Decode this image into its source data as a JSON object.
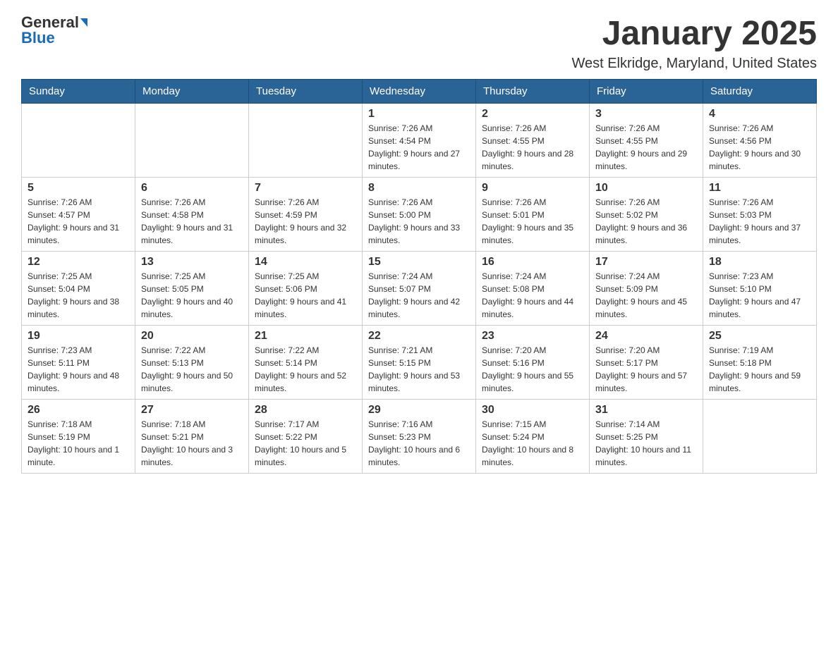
{
  "header": {
    "logo_general": "General",
    "logo_blue": "Blue",
    "title": "January 2025",
    "subtitle": "West Elkridge, Maryland, United States"
  },
  "days_of_week": [
    "Sunday",
    "Monday",
    "Tuesday",
    "Wednesday",
    "Thursday",
    "Friday",
    "Saturday"
  ],
  "weeks": [
    [
      {
        "day": "",
        "info": ""
      },
      {
        "day": "",
        "info": ""
      },
      {
        "day": "",
        "info": ""
      },
      {
        "day": "1",
        "info": "Sunrise: 7:26 AM\nSunset: 4:54 PM\nDaylight: 9 hours and 27 minutes."
      },
      {
        "day": "2",
        "info": "Sunrise: 7:26 AM\nSunset: 4:55 PM\nDaylight: 9 hours and 28 minutes."
      },
      {
        "day": "3",
        "info": "Sunrise: 7:26 AM\nSunset: 4:55 PM\nDaylight: 9 hours and 29 minutes."
      },
      {
        "day": "4",
        "info": "Sunrise: 7:26 AM\nSunset: 4:56 PM\nDaylight: 9 hours and 30 minutes."
      }
    ],
    [
      {
        "day": "5",
        "info": "Sunrise: 7:26 AM\nSunset: 4:57 PM\nDaylight: 9 hours and 31 minutes."
      },
      {
        "day": "6",
        "info": "Sunrise: 7:26 AM\nSunset: 4:58 PM\nDaylight: 9 hours and 31 minutes."
      },
      {
        "day": "7",
        "info": "Sunrise: 7:26 AM\nSunset: 4:59 PM\nDaylight: 9 hours and 32 minutes."
      },
      {
        "day": "8",
        "info": "Sunrise: 7:26 AM\nSunset: 5:00 PM\nDaylight: 9 hours and 33 minutes."
      },
      {
        "day": "9",
        "info": "Sunrise: 7:26 AM\nSunset: 5:01 PM\nDaylight: 9 hours and 35 minutes."
      },
      {
        "day": "10",
        "info": "Sunrise: 7:26 AM\nSunset: 5:02 PM\nDaylight: 9 hours and 36 minutes."
      },
      {
        "day": "11",
        "info": "Sunrise: 7:26 AM\nSunset: 5:03 PM\nDaylight: 9 hours and 37 minutes."
      }
    ],
    [
      {
        "day": "12",
        "info": "Sunrise: 7:25 AM\nSunset: 5:04 PM\nDaylight: 9 hours and 38 minutes."
      },
      {
        "day": "13",
        "info": "Sunrise: 7:25 AM\nSunset: 5:05 PM\nDaylight: 9 hours and 40 minutes."
      },
      {
        "day": "14",
        "info": "Sunrise: 7:25 AM\nSunset: 5:06 PM\nDaylight: 9 hours and 41 minutes."
      },
      {
        "day": "15",
        "info": "Sunrise: 7:24 AM\nSunset: 5:07 PM\nDaylight: 9 hours and 42 minutes."
      },
      {
        "day": "16",
        "info": "Sunrise: 7:24 AM\nSunset: 5:08 PM\nDaylight: 9 hours and 44 minutes."
      },
      {
        "day": "17",
        "info": "Sunrise: 7:24 AM\nSunset: 5:09 PM\nDaylight: 9 hours and 45 minutes."
      },
      {
        "day": "18",
        "info": "Sunrise: 7:23 AM\nSunset: 5:10 PM\nDaylight: 9 hours and 47 minutes."
      }
    ],
    [
      {
        "day": "19",
        "info": "Sunrise: 7:23 AM\nSunset: 5:11 PM\nDaylight: 9 hours and 48 minutes."
      },
      {
        "day": "20",
        "info": "Sunrise: 7:22 AM\nSunset: 5:13 PM\nDaylight: 9 hours and 50 minutes."
      },
      {
        "day": "21",
        "info": "Sunrise: 7:22 AM\nSunset: 5:14 PM\nDaylight: 9 hours and 52 minutes."
      },
      {
        "day": "22",
        "info": "Sunrise: 7:21 AM\nSunset: 5:15 PM\nDaylight: 9 hours and 53 minutes."
      },
      {
        "day": "23",
        "info": "Sunrise: 7:20 AM\nSunset: 5:16 PM\nDaylight: 9 hours and 55 minutes."
      },
      {
        "day": "24",
        "info": "Sunrise: 7:20 AM\nSunset: 5:17 PM\nDaylight: 9 hours and 57 minutes."
      },
      {
        "day": "25",
        "info": "Sunrise: 7:19 AM\nSunset: 5:18 PM\nDaylight: 9 hours and 59 minutes."
      }
    ],
    [
      {
        "day": "26",
        "info": "Sunrise: 7:18 AM\nSunset: 5:19 PM\nDaylight: 10 hours and 1 minute."
      },
      {
        "day": "27",
        "info": "Sunrise: 7:18 AM\nSunset: 5:21 PM\nDaylight: 10 hours and 3 minutes."
      },
      {
        "day": "28",
        "info": "Sunrise: 7:17 AM\nSunset: 5:22 PM\nDaylight: 10 hours and 5 minutes."
      },
      {
        "day": "29",
        "info": "Sunrise: 7:16 AM\nSunset: 5:23 PM\nDaylight: 10 hours and 6 minutes."
      },
      {
        "day": "30",
        "info": "Sunrise: 7:15 AM\nSunset: 5:24 PM\nDaylight: 10 hours and 8 minutes."
      },
      {
        "day": "31",
        "info": "Sunrise: 7:14 AM\nSunset: 5:25 PM\nDaylight: 10 hours and 11 minutes."
      },
      {
        "day": "",
        "info": ""
      }
    ]
  ]
}
